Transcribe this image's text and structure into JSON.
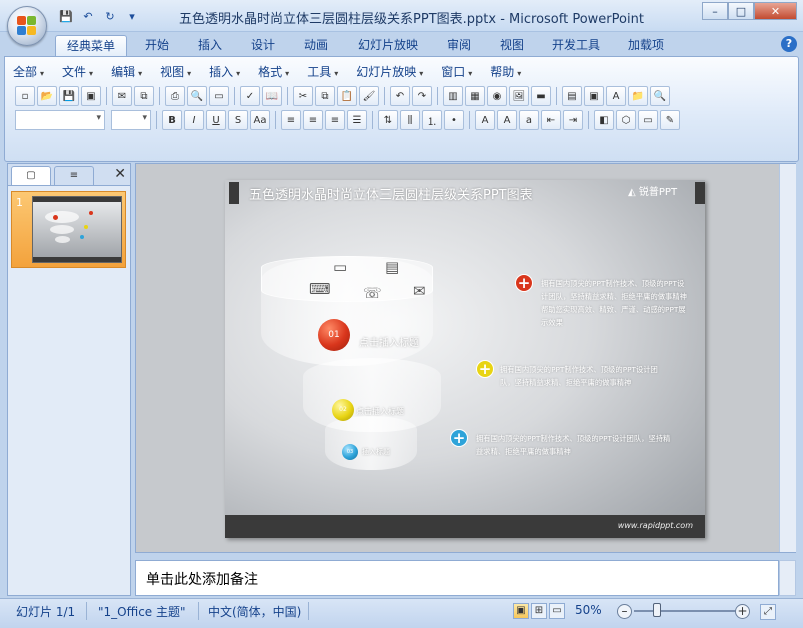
{
  "window": {
    "title": "五色透明水晶时尚立体三层圆柱层级关系PPT图表.pptx - Microsoft PowerPoint",
    "controls": {
      "minimize": "–",
      "maximize": "□",
      "close": "✕"
    }
  },
  "quick_access": {
    "save": "💾",
    "undo": "↶",
    "redo": "↻",
    "customize": "▾"
  },
  "ribbon_tabs": [
    "经典菜单",
    "开始",
    "插入",
    "设计",
    "动画",
    "幻灯片放映",
    "审阅",
    "视图",
    "开发工具",
    "加载项"
  ],
  "active_tab": "经典菜单",
  "classic_menu": [
    "全部",
    "文件",
    "编辑",
    "视图",
    "插入",
    "格式",
    "工具",
    "幻灯片放映",
    "窗口",
    "帮助"
  ],
  "toolbar_font": {
    "font_name": "",
    "font_size": ""
  },
  "left_pane": {
    "tab_slides": "▢",
    "tab_outline": "≡",
    "close": "✕",
    "slide_number": "1"
  },
  "slide": {
    "title": "五色透明水晶时尚立体三层圆柱层级关系PPT图表",
    "logo_text": "锐普PPT",
    "url": "www.rapidppt.com",
    "tiers": [
      {
        "number": "01",
        "label": "点击插入标题",
        "color": "#d9361c"
      },
      {
        "number": "02",
        "label": "点击插入标题",
        "color": "#e8d414"
      },
      {
        "number": "03",
        "label": "插入标题",
        "color": "#2ea3d9"
      }
    ],
    "descriptions": [
      {
        "color": "#d9361c",
        "text": "拥有国内顶尖的PPT制作技术、顶级的PPT设计团队，坚持精益求精、拒绝平庸的做事精神帮助您实现高效、精致、严谨、动感的PPT展示效果"
      },
      {
        "color": "#e8d414",
        "text": "拥有国内顶尖的PPT制作技术、顶级的PPT设计团队，坚持精益求精、拒绝平庸的做事精神"
      },
      {
        "color": "#2ea3d9",
        "text": "拥有国内顶尖的PPT制作技术、顶级的PPT设计团队，坚持精益求精、拒绝平庸的做事精神"
      }
    ]
  },
  "notes": {
    "placeholder": "单击此处添加备注"
  },
  "status_bar": {
    "slide_info": "幻灯片 1/1",
    "theme": "\"1_Office 主题\"",
    "language": "中文(简体，中国)",
    "zoom": "50%"
  }
}
